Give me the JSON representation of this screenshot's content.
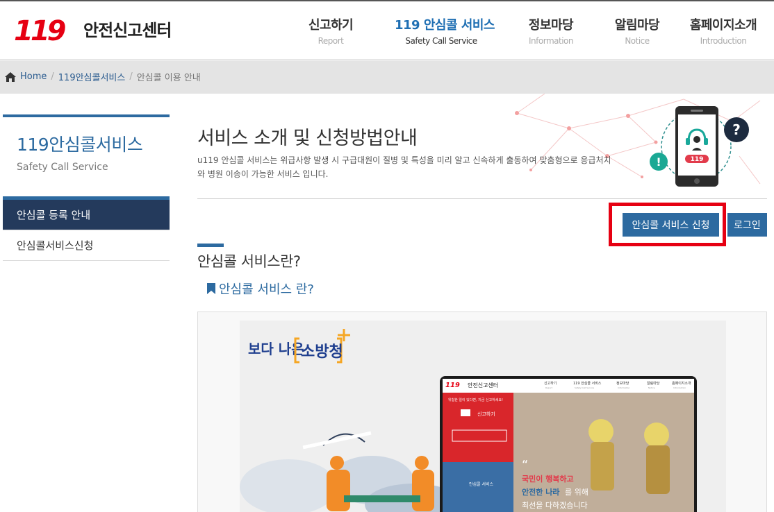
{
  "header": {
    "logo_mark": "119",
    "logo_text": "안전신고센터",
    "nav": [
      {
        "label": "신고하기",
        "sub": "Report"
      },
      {
        "label": "119 안심콜 서비스",
        "sub": "Safety Call Service",
        "active": true
      },
      {
        "label": "정보마당",
        "sub": "Information"
      },
      {
        "label": "알림마당",
        "sub": "Notice"
      },
      {
        "label": "홈페이지소개",
        "sub": "Introduction"
      }
    ]
  },
  "breadcrumb": {
    "home": "Home",
    "level1": "119안심콜서비스",
    "current": "안심콜 이용 안내"
  },
  "sidebar": {
    "title": "119안심콜서비스",
    "subtitle": "Safety Call Service",
    "items": [
      {
        "label": "안심콜 등록 안내",
        "active": true
      },
      {
        "label": "안심콜서비스신청"
      }
    ]
  },
  "main": {
    "title": "서비스 소개 및 신청방법안내",
    "description": "u119 안심콜 서비스는 위급사항 발생 시 구급대원이 질병 및 특성을 미리 알고 신속하게 출동하여 맞춤형으로 응급처치와 병원 이송이 가능한 서비스 입니다.",
    "apply_button": "안심콜 서비스 신청",
    "login_button": "로그인",
    "section_title": "안심콜 서비스란?",
    "subsection_title": "안심콜 서비스 란?",
    "phone_badge": "119"
  },
  "banner": {
    "slogan_part1": "보다 나은",
    "slogan_part2": "소방청",
    "mini_logo_text": "안전신고센터",
    "mini_nav": [
      "신고하기",
      "119 안심콜 서비스",
      "정보마당",
      "알림마당",
      "홈페이지소개"
    ],
    "mini_nav_sub": [
      "Report",
      "Safety Call Service",
      "Information",
      "Notice",
      "Introduction"
    ],
    "mini_notice": "위험한 일이 있다면, 지금 신고하세요!",
    "mini_report": "신고하기",
    "mini_safety": "안심콜 서비스",
    "quote_line1a": "국민이 행복하고",
    "quote_line2a": "안전한 나라",
    "quote_line2b": "를 위해",
    "quote_line3": "최선을 다하겠습니다"
  },
  "colors": {
    "primary": "#2d6aa0",
    "sidebar_active": "#243a5c",
    "logo_red": "#e60012",
    "highlight_border": "#e60012",
    "slogan_orange": "#f5a623"
  }
}
